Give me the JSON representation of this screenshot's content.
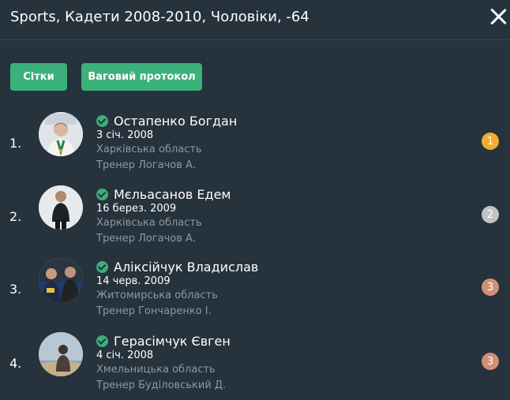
{
  "header": {
    "title": "Sports, Кадети 2008-2010, Чоловіки, -64"
  },
  "toolbar": {
    "grids_label": "Сітки",
    "weigh_label": "Ваговий протокол"
  },
  "colors": {
    "accent": "#3bb07a",
    "background": "#26323c",
    "muted_text": "#8c98a3",
    "gold": "#f0ad2e",
    "silver": "#c2c2c2",
    "bronze": "#d08f76"
  },
  "icons": {
    "close": "close-icon",
    "verified": "check-circle-icon",
    "place": "medal-icon"
  },
  "athletes": [
    {
      "rank": "1.",
      "name": "Остапенко Богдан",
      "dob": "3 січ. 2008",
      "region": "Харківська область",
      "coach": "Тренер Логачов А.",
      "place": "1",
      "place_color": "#f0ad2e"
    },
    {
      "rank": "2.",
      "name": "Мєльасанов Едем",
      "dob": "16 берез. 2009",
      "region": "Харківська область",
      "coach": "Тренер Логачов А.",
      "place": "2",
      "place_color": "#c2c2c2"
    },
    {
      "rank": "3.",
      "name": "Аліксійчук Владислав",
      "dob": "14 черв. 2009",
      "region": "Житомирська область",
      "coach": "Тренер Гончаренко І.",
      "place": "3",
      "place_color": "#d08f76"
    },
    {
      "rank": "4.",
      "name": "Герасімчук Євген",
      "dob": "4 січ. 2008",
      "region": "Хмельницька область",
      "coach": "Тренер Буділовський Д.",
      "place": "3",
      "place_color": "#d08f76"
    }
  ]
}
